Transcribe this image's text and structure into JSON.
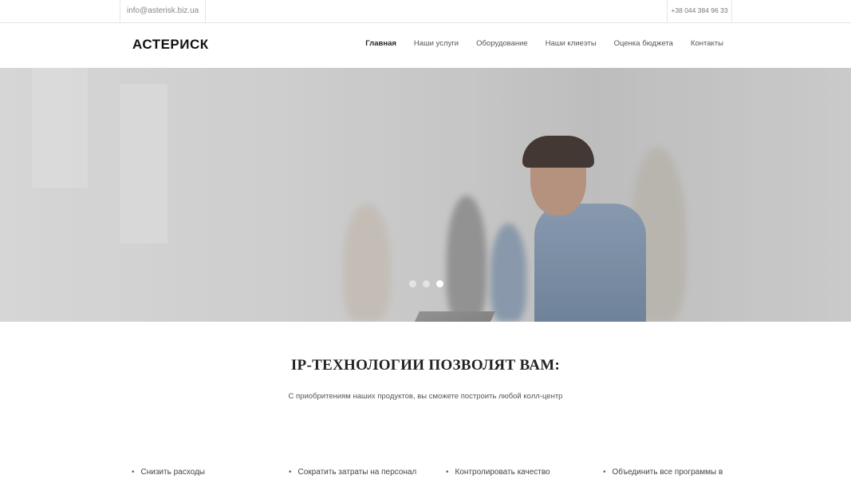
{
  "topbar": {
    "email": "info@asterisk.biz.ua",
    "phone": "+38 044 384 96 33"
  },
  "header": {
    "logo": "АСТЕРИСК",
    "nav": [
      {
        "label": "Главная",
        "active": true
      },
      {
        "label": "Наши услуги",
        "active": false
      },
      {
        "label": "Оборудование",
        "active": false
      },
      {
        "label": "Наши клиеэты",
        "active": false
      },
      {
        "label": "Оценка бюджета",
        "active": false
      },
      {
        "label": "Контакты",
        "active": false
      }
    ]
  },
  "hero": {
    "slides_count": 3,
    "active_slide": 3
  },
  "section": {
    "title": "IP-ТЕХНОЛОГИИ ПОЗВОЛЯТ ВАМ:",
    "subtitle": "С приобритениям наших продуктов, вы сможете построить любой колл-центр"
  },
  "features": [
    "Снизить расходы",
    "Сократить затраты на персонал",
    "Контролировать качество",
    "Объединить все программы в"
  ]
}
